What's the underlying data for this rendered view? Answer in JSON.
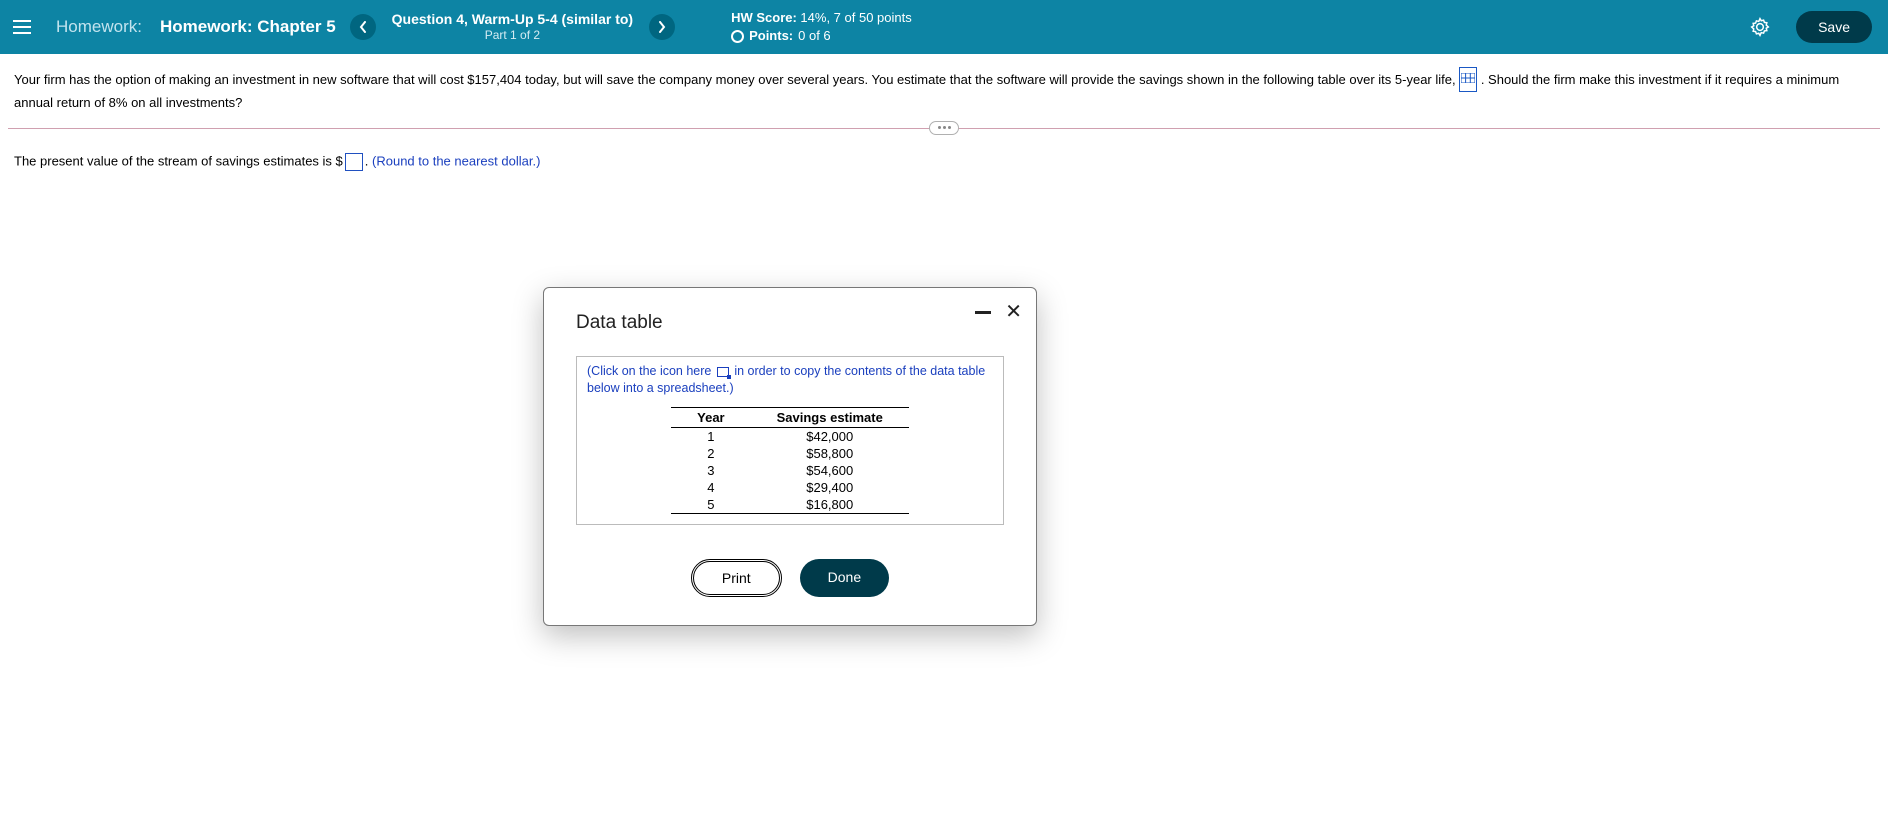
{
  "header": {
    "homework_label": "Homework:",
    "homework_title": "Homework: Chapter 5",
    "question_title": "Question 4, Warm-Up 5-4 (similar to)",
    "question_part": "Part 1 of 2",
    "hw_score_label": "HW Score:",
    "hw_score_value": " 14%, 7 of 50 points",
    "points_label": "Points:",
    "points_value": " 0 of 6",
    "save_label": "Save"
  },
  "question": {
    "text_a": "Your firm has the option of making an investment in new software that will cost $157,404 today, but will save the company money over several years. You estimate that the software will provide the savings shown in the following table over its 5-year life, ",
    "text_b": " .  Should the firm make this investment if it requires a minimum annual return of 8% on all investments?"
  },
  "answer": {
    "prefix": "The present value of the stream of savings estimates is $",
    "suffix": ".  ",
    "note": "(Round to the nearest dollar.)"
  },
  "modal": {
    "title": "Data table",
    "copy_a": "(Click on the icon here ",
    "copy_b": " in order to copy the contents of the data table below into a spreadsheet.)",
    "col_year": "Year",
    "col_savings": "Savings estimate",
    "rows": [
      {
        "year": "1",
        "val": "$42,000"
      },
      {
        "year": "2",
        "val": "$58,800"
      },
      {
        "year": "3",
        "val": "$54,600"
      },
      {
        "year": "4",
        "val": "$29,400"
      },
      {
        "year": "5",
        "val": "$16,800"
      }
    ],
    "print_label": "Print",
    "done_label": "Done"
  }
}
